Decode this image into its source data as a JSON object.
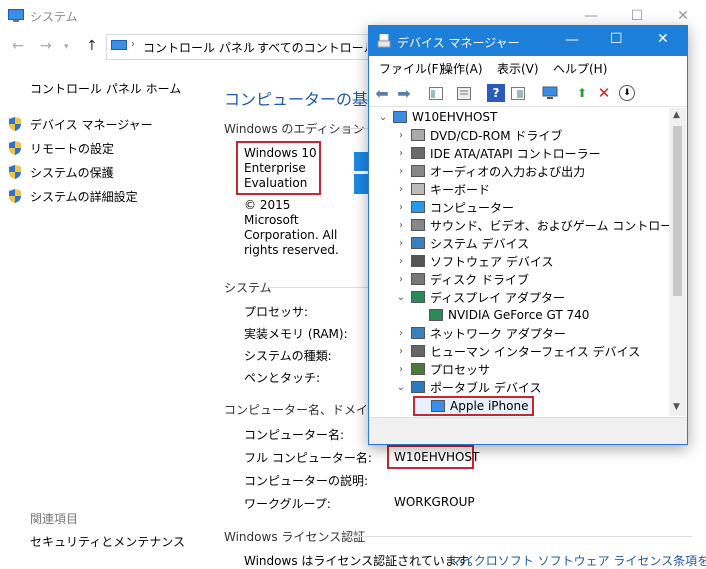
{
  "system_window": {
    "title": "システム",
    "address": [
      "コントロール パネル",
      "すべてのコントロール パネ"
    ],
    "sidebar": {
      "home": "コントロール パネル ホーム",
      "links": [
        "デバイス マネージャー",
        "リモートの設定",
        "システムの保護",
        "システムの詳細設定"
      ],
      "related_header": "関連項目",
      "related_links": [
        "セキュリティとメンテナンス"
      ]
    },
    "heading": "コンピューターの基本的な",
    "edition": {
      "header": "Windows のエディション",
      "lines": [
        "Windows 10",
        "Enterprise",
        "Evaluation"
      ],
      "copyright": [
        "© 2015",
        "Microsoft",
        "Corporation. All",
        "rights reserved."
      ]
    },
    "system": {
      "header": "システム",
      "rows": [
        "プロセッサ:",
        "実装メモリ (RAM):",
        "システムの種類:",
        "ペンとタッチ:"
      ]
    },
    "computer_name": {
      "header": "コンピューター名、ドメインおよび",
      "rows": [
        {
          "label": "コンピューター名:",
          "value": ""
        },
        {
          "label": "フル コンピューター名:",
          "value": "W10EHVHOST"
        },
        {
          "label": "コンピューターの説明:",
          "value": ""
        },
        {
          "label": "ワークグループ:",
          "value": "WORKGROUP"
        }
      ]
    },
    "license": {
      "header": "Windows ライセンス認証",
      "status": "Windows はライセンス認証されています。",
      "link": "マイクロソフト ソフトウェア ライセンス条項を読む"
    }
  },
  "device_manager": {
    "title": "デバイス マネージャー",
    "menu": [
      "ファイル(F)",
      "操作(A)",
      "表示(V)",
      "ヘルプ(H)"
    ],
    "tree": [
      {
        "label": "W10EHVHOST",
        "level": 0,
        "state": "expanded",
        "icon": "computer-icon"
      },
      {
        "label": "DVD/CD-ROM ドライブ",
        "level": 1,
        "state": "collapsed",
        "icon": "dvd-drive-icon"
      },
      {
        "label": "IDE ATA/ATAPI コントローラー",
        "level": 1,
        "state": "collapsed",
        "icon": "ide-controller-icon"
      },
      {
        "label": "オーディオの入力および出力",
        "level": 1,
        "state": "collapsed",
        "icon": "speaker-icon"
      },
      {
        "label": "キーボード",
        "level": 1,
        "state": "collapsed",
        "icon": "keyboard-icon"
      },
      {
        "label": "コンピューター",
        "level": 1,
        "state": "collapsed",
        "icon": "monitor-icon"
      },
      {
        "label": "サウンド、ビデオ、およびゲーム コントローラー",
        "level": 1,
        "state": "collapsed",
        "icon": "speaker-icon"
      },
      {
        "label": "システム デバイス",
        "level": 1,
        "state": "collapsed",
        "icon": "system-device-icon"
      },
      {
        "label": "ソフトウェア デバイス",
        "level": 1,
        "state": "collapsed",
        "icon": "software-device-icon"
      },
      {
        "label": "ディスク ドライブ",
        "level": 1,
        "state": "collapsed",
        "icon": "disk-drive-icon"
      },
      {
        "label": "ディスプレイ アダプター",
        "level": 1,
        "state": "expanded",
        "icon": "display-adapter-icon"
      },
      {
        "label": "NVIDIA GeForce GT 740",
        "level": 2,
        "state": "leaf",
        "icon": "display-adapter-icon"
      },
      {
        "label": "ネットワーク アダプター",
        "level": 1,
        "state": "collapsed",
        "icon": "network-adapter-icon"
      },
      {
        "label": "ヒューマン インターフェイス デバイス",
        "level": 1,
        "state": "collapsed",
        "icon": "hid-icon"
      },
      {
        "label": "プロセッサ",
        "level": 1,
        "state": "collapsed",
        "icon": "processor-icon"
      },
      {
        "label": "ポータブル デバイス",
        "level": 1,
        "state": "expanded",
        "icon": "portable-device-icon"
      },
      {
        "label": "Apple iPhone",
        "level": 2,
        "state": "leaf",
        "icon": "phone-icon"
      }
    ]
  },
  "colors": {
    "accent": "#1e7fd9",
    "highlight_box": "#c8282d",
    "link": "#1e5aa8"
  }
}
